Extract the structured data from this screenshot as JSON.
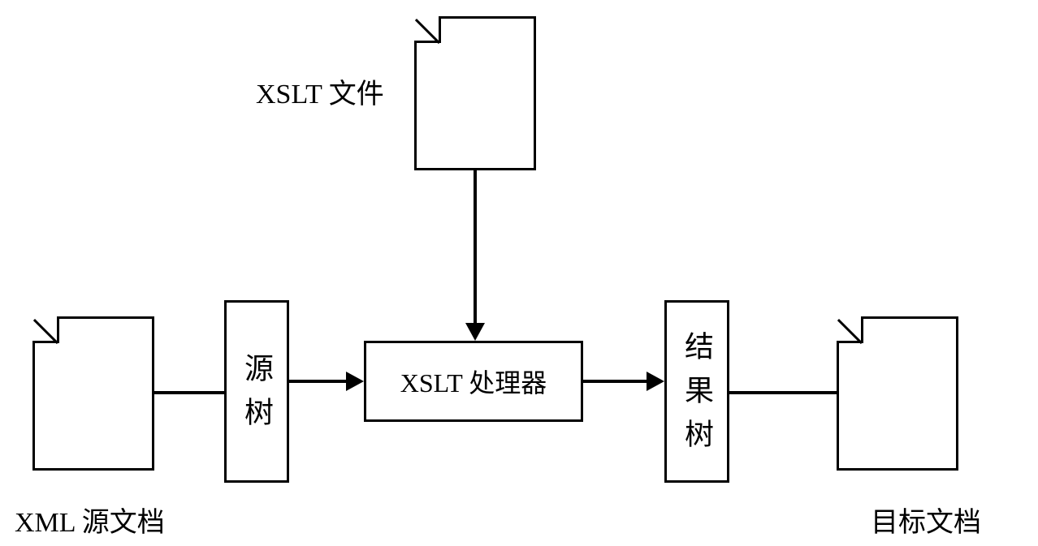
{
  "nodes": {
    "xslt_file_label": "XSLT 文件",
    "source_tree": "源树",
    "processor": "XSLT 处理器",
    "result_tree": "结果树",
    "xml_source_doc_label": "XML 源文档",
    "target_doc_label": "目标文档"
  }
}
